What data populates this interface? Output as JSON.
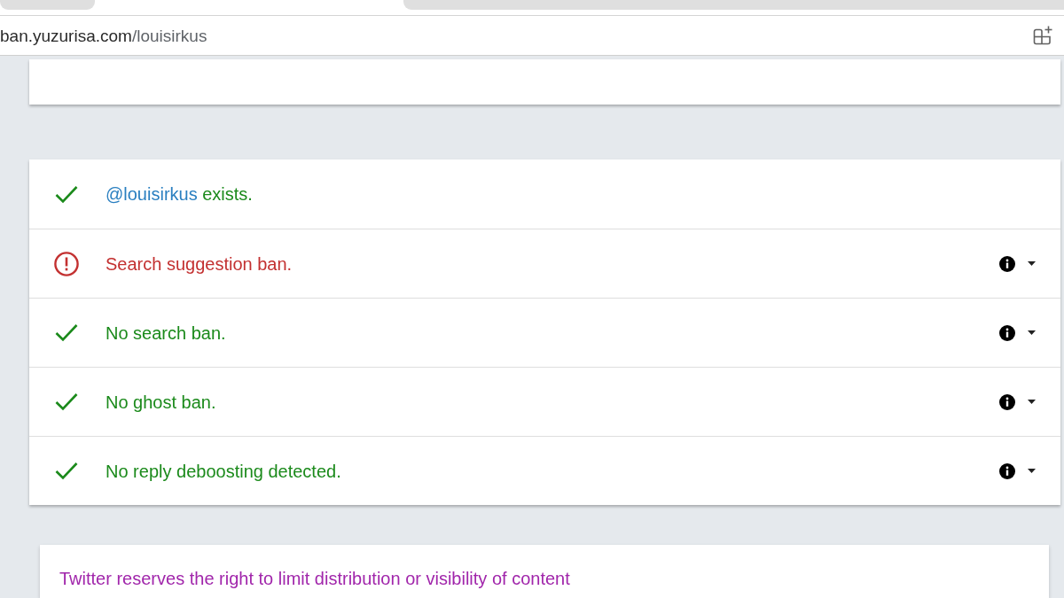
{
  "address_bar": {
    "host": "ban.yuzurisa.com",
    "path": "/louisirkus"
  },
  "checks": [
    {
      "kind": "pass",
      "handle": "@louisirkus",
      "text": "exists.",
      "details": false
    },
    {
      "kind": "fail",
      "text": "Search suggestion ban.",
      "details": true
    },
    {
      "kind": "pass",
      "text": "No search ban.",
      "details": true
    },
    {
      "kind": "pass",
      "text": "No ghost ban.",
      "details": true
    },
    {
      "kind": "pass",
      "text": "No reply deboosting detected.",
      "details": true
    }
  ],
  "notice": {
    "text": "Twitter reserves the right to limit distribution or visibility of content"
  }
}
